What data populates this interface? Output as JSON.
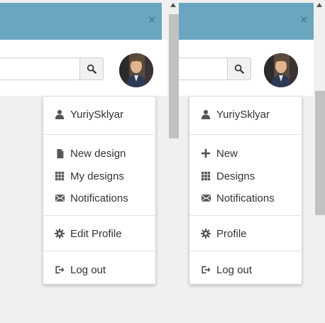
{
  "colors": {
    "header": "#6aa6bf",
    "menu_text": "#333333",
    "icon": "#555555"
  },
  "left_panel": {
    "close_glyph": "×",
    "search_icon": "search-icon",
    "user_menu": {
      "username": "YuriySklyar",
      "items": [
        {
          "label": "New design",
          "icon": "file-icon"
        },
        {
          "label": "My designs",
          "icon": "grid-icon"
        },
        {
          "label": "Notifications",
          "icon": "envelope-icon"
        },
        {
          "label": "Edit Profile",
          "icon": "gear-icon"
        },
        {
          "label": "Log out",
          "icon": "logout-icon"
        }
      ]
    }
  },
  "right_panel": {
    "close_glyph": "×",
    "search_icon": "search-icon",
    "user_menu": {
      "username": "YuriySklyar",
      "items": [
        {
          "label": "New",
          "icon": "plus-icon"
        },
        {
          "label": "Designs",
          "icon": "grid-icon"
        },
        {
          "label": "Notifications",
          "icon": "envelope-icon"
        },
        {
          "label": "Profile",
          "icon": "gear-icon"
        },
        {
          "label": "Log out",
          "icon": "logout-icon"
        }
      ]
    }
  }
}
